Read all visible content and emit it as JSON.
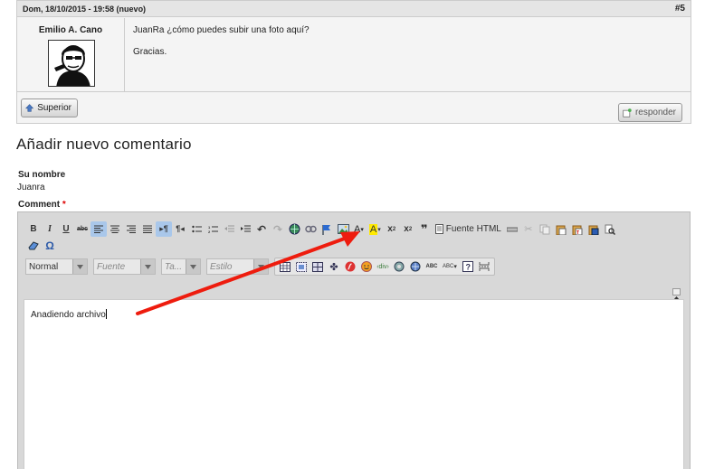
{
  "comment": {
    "date": "Dom, 18/10/2015 - 19:58 (nuevo)",
    "number": "#5",
    "author": "Emilio A. Cano",
    "message_lines": [
      "JuanRa ¿cómo puedes subir una foto aquí?",
      "Gracias."
    ],
    "superior_label": "Superior",
    "reply_label": "responder"
  },
  "form": {
    "title": "Añadir nuevo comentario",
    "name_label": "Su nombre",
    "name_value": "Juanra",
    "comment_label": "Comment",
    "required_mark": "*"
  },
  "editor": {
    "source_label": "Fuente HTML",
    "format_value": "Normal",
    "font_placeholder": "Fuente",
    "size_placeholder": "Ta...",
    "style_placeholder": "Estilo",
    "content": "Anadiendo archivo",
    "toolbar_icons": [
      "bold",
      "italic",
      "underline",
      "strike",
      "align-left",
      "align-center",
      "align-right",
      "justify",
      "ltr",
      "rtl",
      "bullet-list",
      "number-list",
      "outdent",
      "indent",
      "undo",
      "redo",
      "link",
      "unlink",
      "anchor",
      "image",
      "text-color",
      "bg-color",
      "superscript",
      "subscript",
      "blockquote",
      "source",
      "hr",
      "cut",
      "copy",
      "paste",
      "paste-text",
      "paste-word",
      "find",
      "eraser",
      "omega",
      "table",
      "div",
      "iframe",
      "flash",
      "smiley",
      "special",
      "replace",
      "spell",
      "spell-options",
      "help",
      "page-break"
    ]
  },
  "colors": {
    "accent_active": "#a9c7ea",
    "arrow": "#ee1c0e",
    "required": "#dd0000"
  }
}
